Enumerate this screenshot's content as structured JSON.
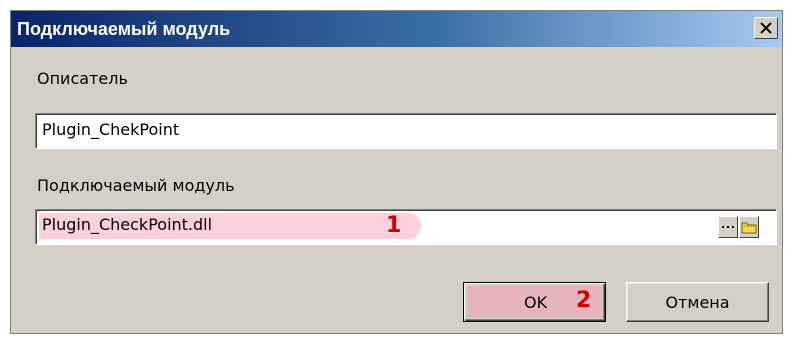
{
  "window": {
    "title": "Подключаемый модуль",
    "close_icon": "close-x-icon"
  },
  "form": {
    "descriptor_label": "Описатель",
    "descriptor_value": "Plugin_ChekPoint",
    "module_label": "Подключаемый модуль",
    "module_value": "Plugin_CheckPoint.dll",
    "browse_icon": "ellipsis-icon",
    "folder_icon": "folder-icon"
  },
  "buttons": {
    "ok_label": "OK",
    "cancel_label": "Отмена"
  },
  "annotations": {
    "marker_1": "1",
    "marker_2": "2",
    "highlight_color": "#fbd0dc",
    "marker_color": "#cc0000"
  }
}
